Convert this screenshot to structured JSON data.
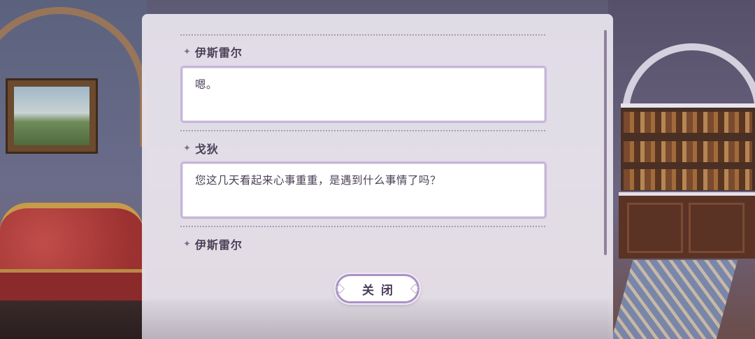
{
  "dialog_log": {
    "entries": [
      {
        "speaker": "伊斯雷尔",
        "text": "嗯。"
      },
      {
        "speaker": "戈狄",
        "text": "您这几天看起来心事重重，是遇到什么事情了吗？"
      },
      {
        "speaker": "伊斯雷尔",
        "text": ""
      }
    ],
    "close_label": "关闭"
  },
  "colors": {
    "panel_bg": "#ece7f0",
    "accent_purple": "#a893c4",
    "text": "#4a4156"
  },
  "icons": {
    "speaker_marker": "sparkle-icon"
  }
}
